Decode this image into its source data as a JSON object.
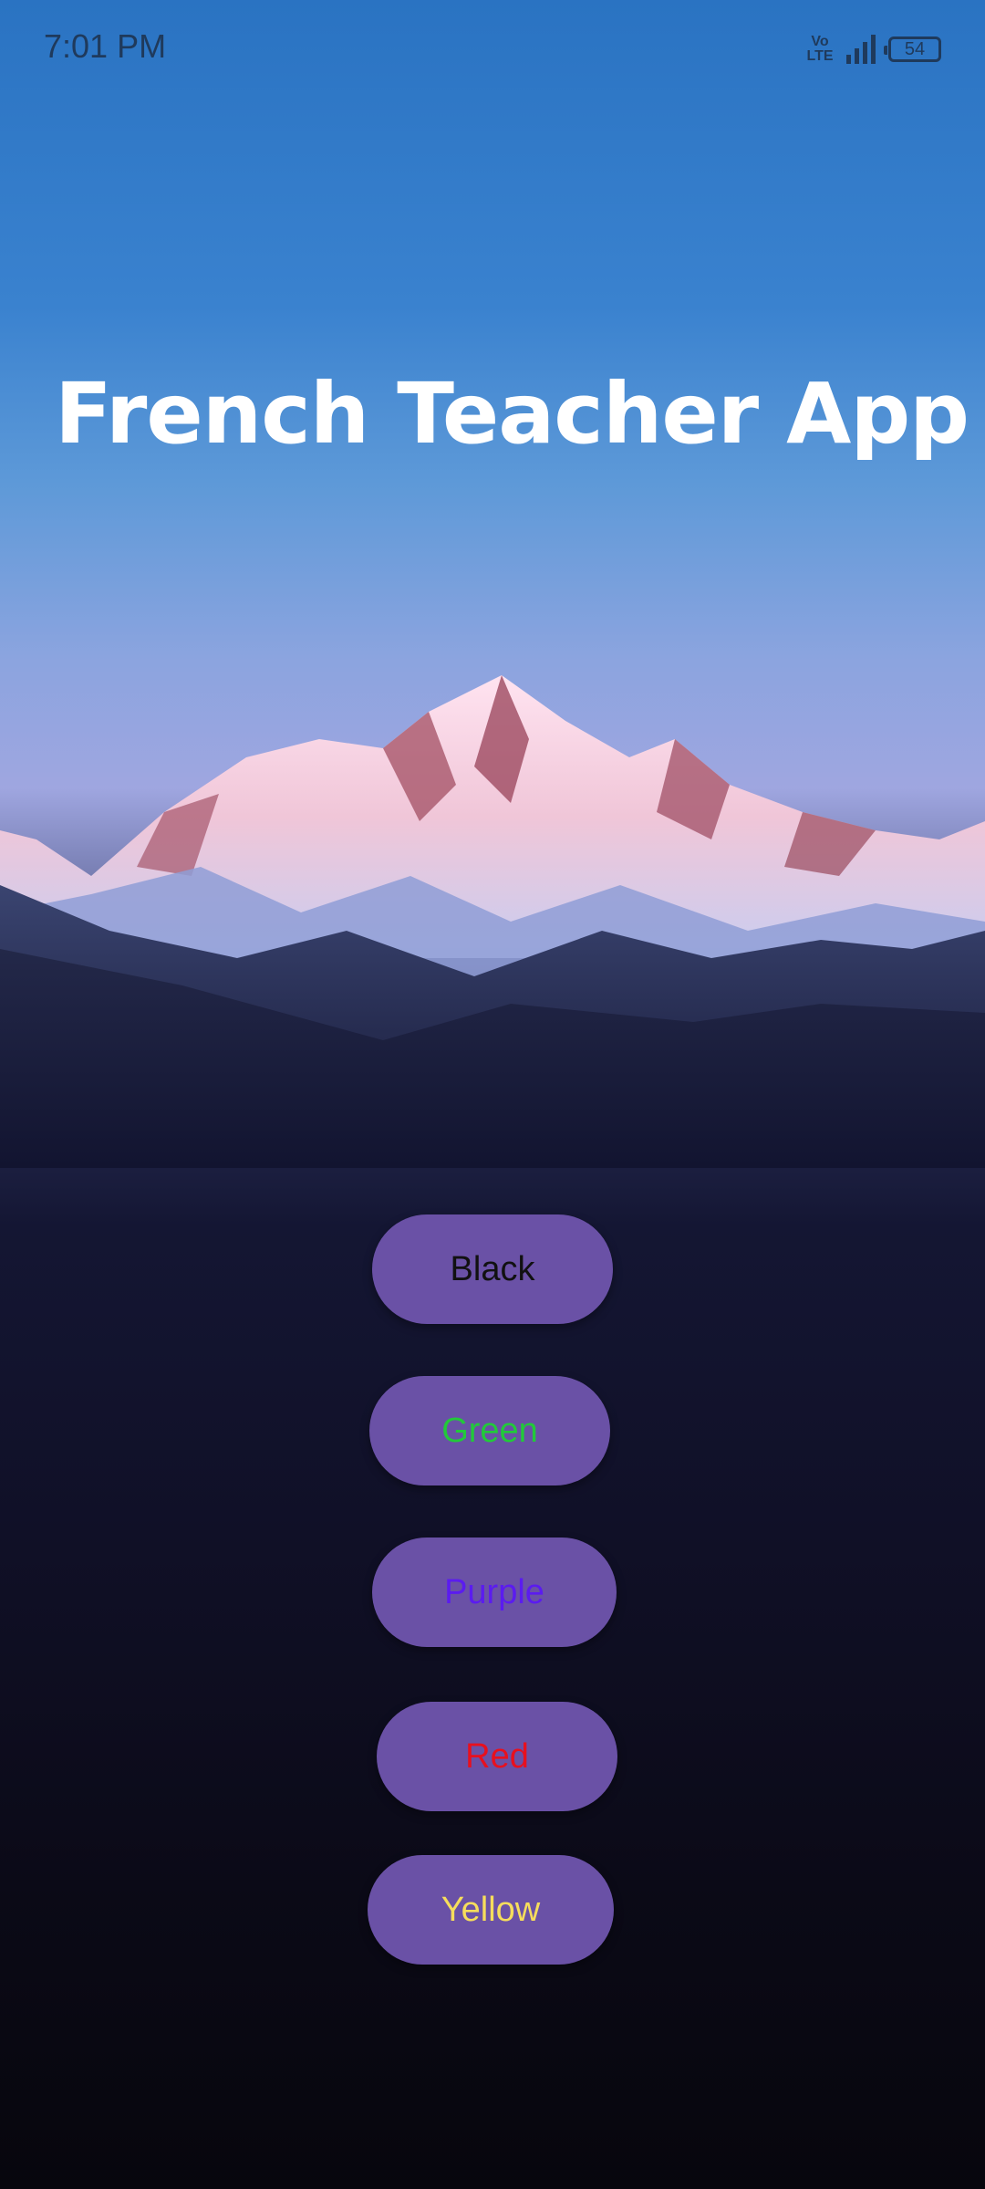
{
  "status_bar": {
    "time": "7:01 PM",
    "volte_top": "Vo",
    "volte_bottom": "LTE",
    "battery": "54"
  },
  "app": {
    "title": "French Teacher App"
  },
  "buttons": [
    {
      "label": "Black",
      "color": "#111111"
    },
    {
      "label": "Green",
      "color": "#22c93a"
    },
    {
      "label": "Purple",
      "color": "#5b1bf0"
    },
    {
      "label": "Red",
      "color": "#e8101e"
    },
    {
      "label": "Yellow",
      "color": "#f6dd5c"
    }
  ],
  "colors": {
    "button_bg": "#6a51a6",
    "title": "#ffffff"
  }
}
